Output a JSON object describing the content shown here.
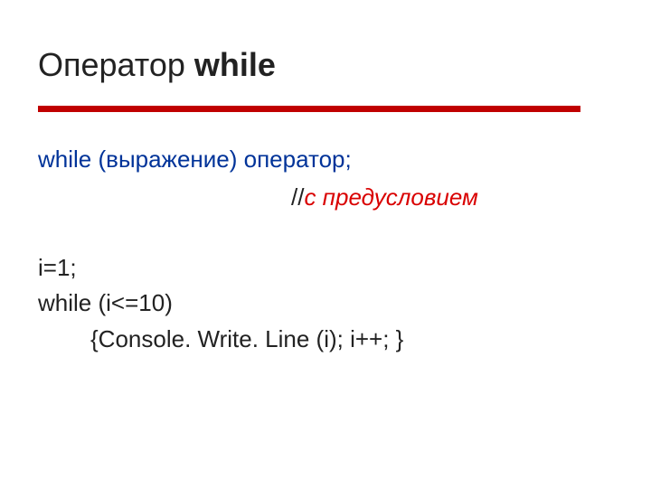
{
  "title": {
    "text_plain": "Оператор ",
    "text_bold": "while"
  },
  "syntax": {
    "keyword": "while",
    "rest": " (выражение) оператор;"
  },
  "comment": {
    "slashes": "//",
    "text": "с предусловием"
  },
  "code": {
    "line1": "i=1;",
    "line2": "while (i<=10)",
    "line3": "{Console. Write. Line (i); i++; }"
  }
}
